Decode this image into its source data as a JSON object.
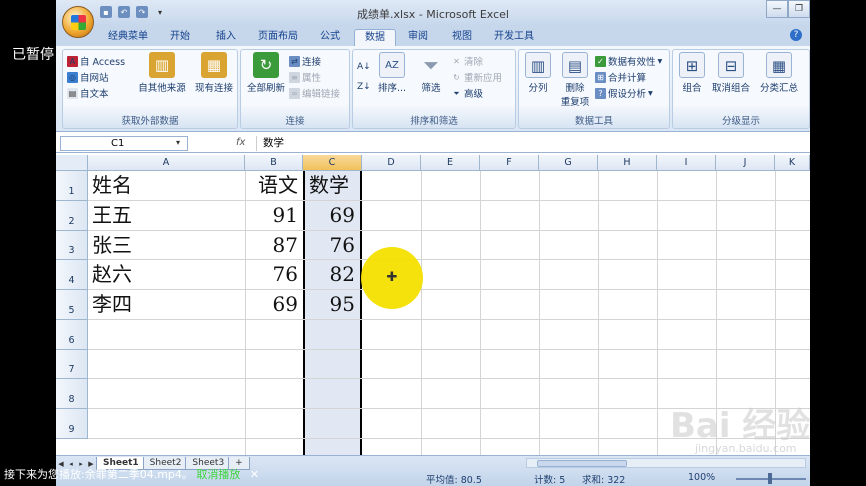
{
  "overlay": {
    "paused_label": "已暂停",
    "next_message": "接下来为您播放:余罪第二季04.mp4。",
    "cancel_label": "取消播放",
    "close_glyph": "✕",
    "watermark": "Bai 经验",
    "watermark_url": "jingyan.baidu.com"
  },
  "window": {
    "title": "成绩单.xlsx - Microsoft Excel",
    "minimize": "—",
    "restore": "❐"
  },
  "tabs": [
    "经典菜单",
    "开始",
    "插入",
    "页面布局",
    "公式",
    "数据",
    "审阅",
    "视图",
    "开发工具"
  ],
  "active_tab": "数据",
  "ribbon": {
    "external": {
      "label": "获取外部数据",
      "access": "自 Access",
      "web": "自网站",
      "text": "自文本",
      "other": "自其他来源",
      "existing": "现有连接"
    },
    "connections": {
      "label": "连接",
      "refresh_all": "全部刷新",
      "connections": "连接",
      "properties": "属性",
      "edit_links": "编辑链接"
    },
    "sort_filter": {
      "label": "排序和筛选",
      "sort": "排序...",
      "filter": "筛选",
      "clear": "清除",
      "reapply": "重新应用",
      "advanced": "高级"
    },
    "data_tools": {
      "label": "数据工具",
      "split": "分列",
      "remove_dup_1": "删除",
      "remove_dup_2": "重复项",
      "validation": "数据有效性",
      "consolidate": "合并计算",
      "whatif": "假设分析"
    },
    "outline": {
      "label": "分级显示",
      "group": "组合",
      "ungroup": "取消组合",
      "subtotal": "分类汇总"
    }
  },
  "formula_bar": {
    "name_box": "C1",
    "fx": "fx",
    "content": "数学"
  },
  "columns": [
    "A",
    "B",
    "C",
    "D",
    "E",
    "F",
    "G",
    "H",
    "I",
    "J",
    "K"
  ],
  "rows": [
    "1",
    "2",
    "3",
    "4",
    "5",
    "6",
    "7",
    "8",
    "9"
  ],
  "table": {
    "headers": [
      "姓名",
      "语文",
      "数学"
    ],
    "data": [
      [
        "王五",
        "91",
        "69"
      ],
      [
        "张三",
        "87",
        "76"
      ],
      [
        "赵六",
        "76",
        "82"
      ],
      [
        "李四",
        "69",
        "95"
      ]
    ]
  },
  "sheets": [
    "Sheet1",
    "Sheet2",
    "Sheet3"
  ],
  "status": {
    "average": "平均值: 80.5",
    "count": "计数: 5",
    "sum": "求和: 322",
    "zoom": "100%"
  },
  "colors": {
    "selected_column": "#e2e8f3",
    "highlight": "#f4e000",
    "ribbon_text": "#1f3f6e"
  }
}
